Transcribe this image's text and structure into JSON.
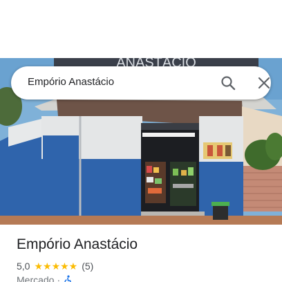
{
  "search": {
    "query": "Empório Anastácio"
  },
  "photo": {
    "sign_text": "ANASTÁCIO"
  },
  "place": {
    "name": "Empório Anastácio",
    "rating": "5,0",
    "stars": "★★★★★",
    "review_count": "(5)",
    "category": "Mercado",
    "separator": "·"
  },
  "icons": {
    "search": "search-icon",
    "close": "close-icon",
    "accessibility": "wheelchair-icon"
  },
  "colors": {
    "star": "#fbbc04",
    "wall_blue": "#2f64ac",
    "wheelchair": "#1a73e8"
  }
}
